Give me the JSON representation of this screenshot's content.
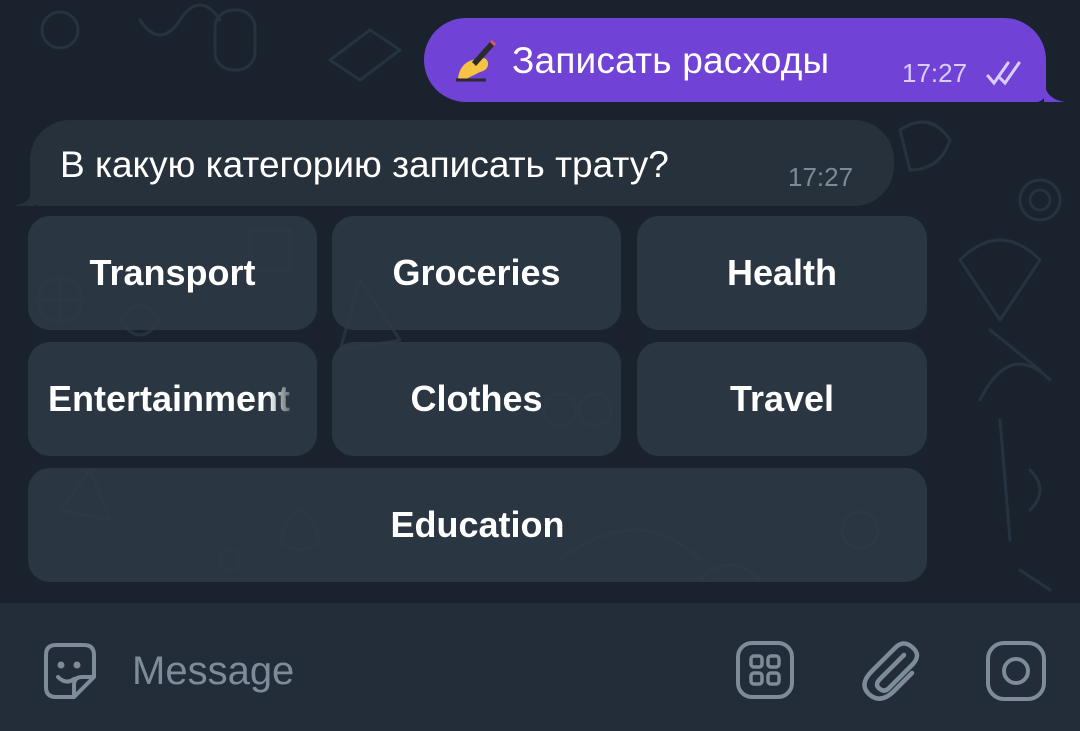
{
  "messages": {
    "outgoing": {
      "emoji": "writing-hand-emoji",
      "text": "Записать расходы",
      "time": "17:27",
      "status": "read-double-check"
    },
    "incoming": {
      "text": "В какую категорию записать трату?",
      "time": "17:27"
    }
  },
  "keyboard": {
    "rows": [
      [
        "Transport",
        "Groceries",
        "Health"
      ],
      [
        "Entertainment",
        "Clothes",
        "Travel"
      ],
      [
        "Education"
      ]
    ]
  },
  "composer": {
    "placeholder": "Message",
    "icons": [
      "sticker-emoji-icon",
      "bot-commands-icon",
      "attach-paperclip-icon",
      "camera-record-icon"
    ]
  },
  "colors": {
    "outgoing_bubble": "#7043d6",
    "incoming_bubble": "#27313c",
    "chat_background": "#1a232d",
    "composer_background": "#222d39"
  }
}
